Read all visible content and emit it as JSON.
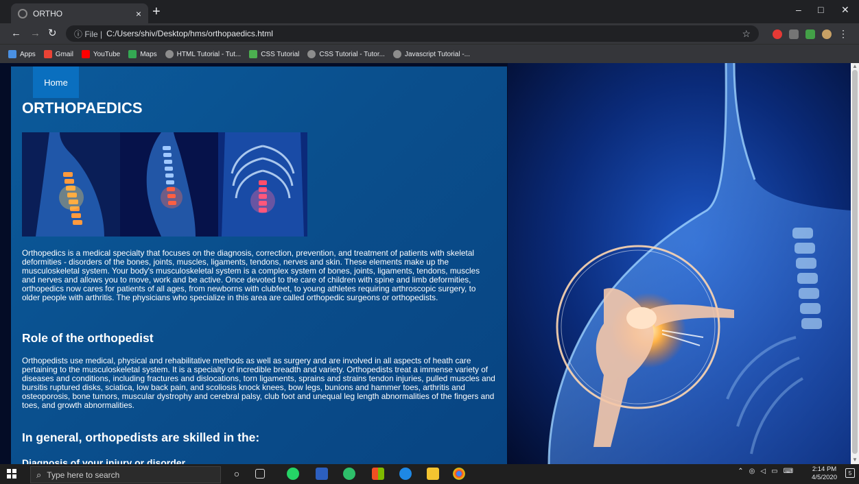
{
  "browser": {
    "tab_title": "ORTHO",
    "tab_close": "×",
    "new_tab": "+",
    "address_info": "ⓘ File |",
    "address_url": "C:/Users/shiv/Desktop/hms/orthopaedics.html",
    "bookmarks": [
      {
        "label": "Apps",
        "color": "#4a90e2"
      },
      {
        "label": "Gmail",
        "color": "#ea4335"
      },
      {
        "label": "YouTube",
        "color": "#ff0000"
      },
      {
        "label": "Maps",
        "color": "#34a853"
      },
      {
        "label": "HTML Tutorial - Tut...",
        "color": "#8d8d8d"
      },
      {
        "label": "CSS Tutorial",
        "color": "#4caf50"
      },
      {
        "label": "CSS Tutorial - Tutor...",
        "color": "#8d8d8d"
      },
      {
        "label": "Javascript Tutorial -...",
        "color": "#8d8d8d"
      }
    ]
  },
  "page": {
    "home_label": "Home",
    "title": "ORTHOPAEDICS",
    "intro": "Orthopedics is a medical specialty that focuses on the diagnosis, correction, prevention, and treatment of patients with skeletal deformities - disorders of the bones, joints, muscles, ligaments, tendons, nerves and skin. These elements make up the musculoskeletal system. Your body's musculoskeletal system is a complex system of bones, joints, ligaments, tendons, muscles and nerves and allows you to move, work and be active. Once devoted to the care of children with spine and limb deformities, orthopedics now cares for patients of all ages, from newborns with clubfeet, to young athletes requiring arthroscopic surgery, to older people with arthritis. The physicians who specialize in this area are called orthopedic surgeons or orthopedists.",
    "role_heading": "Role of the orthopedist",
    "role_text": "Orthopedists use medical, physical and rehabilitative methods as well as surgery and are involved in all aspects of heath care pertaining to the musculoskeletal system. It is a specialty of incredible breadth and variety. Orthopedists treat a immense variety of diseases and conditions, including fractures and dislocations, torn ligaments, sprains and strains tendon injuries, pulled muscles and bursitis ruptured disks, sciatica, low back pain, and scoliosis knock knees, bow legs, bunions and hammer toes, arthritis and osteoporosis, bone tumors, muscular dystrophy and cerebral palsy, club foot and unequal leg length abnormalities of the fingers and toes, and growth abnormalities.",
    "skills_heading": "In general, orthopedists are skilled in the:",
    "skills_first": "Diagnosis of your injury or disorder"
  },
  "taskbar": {
    "search_placeholder": "Type here to search",
    "time": "2:14 PM",
    "date": "4/5/2020",
    "notifications": "5"
  },
  "colors": {
    "panel": "#0a4f8d",
    "home_btn": "#0a6fbf"
  }
}
